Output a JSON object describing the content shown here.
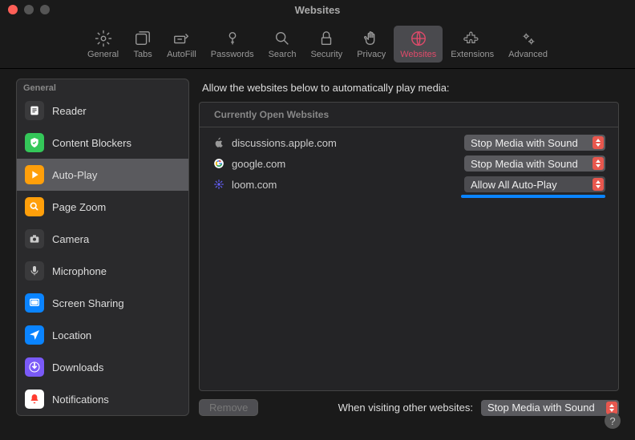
{
  "window_title": "Websites",
  "toolbar": [
    {
      "id": "general",
      "label": "General"
    },
    {
      "id": "tabs",
      "label": "Tabs"
    },
    {
      "id": "autofill",
      "label": "AutoFill"
    },
    {
      "id": "passwords",
      "label": "Passwords"
    },
    {
      "id": "search",
      "label": "Search"
    },
    {
      "id": "security",
      "label": "Security"
    },
    {
      "id": "privacy",
      "label": "Privacy"
    },
    {
      "id": "websites",
      "label": "Websites",
      "selected": true
    },
    {
      "id": "extensions",
      "label": "Extensions"
    },
    {
      "id": "advanced",
      "label": "Advanced"
    }
  ],
  "sidebar": {
    "header": "General",
    "items": [
      {
        "id": "reader",
        "label": "Reader"
      },
      {
        "id": "blockers",
        "label": "Content Blockers"
      },
      {
        "id": "autoplay",
        "label": "Auto-Play",
        "active": true
      },
      {
        "id": "zoom",
        "label": "Page Zoom"
      },
      {
        "id": "camera",
        "label": "Camera"
      },
      {
        "id": "mic",
        "label": "Microphone"
      },
      {
        "id": "share",
        "label": "Screen Sharing"
      },
      {
        "id": "location",
        "label": "Location"
      },
      {
        "id": "downloads",
        "label": "Downloads"
      },
      {
        "id": "notif",
        "label": "Notifications"
      }
    ]
  },
  "main": {
    "header": "Allow the websites below to automatically play media:",
    "list_title": "Currently Open Websites",
    "rows": [
      {
        "site": "discussions.apple.com",
        "value": "Stop Media with Sound",
        "icon": "apple"
      },
      {
        "site": "google.com",
        "value": "Stop Media with Sound",
        "icon": "google"
      },
      {
        "site": "loom.com",
        "value": "Allow All Auto-Play",
        "icon": "loom",
        "highlighted": true
      }
    ],
    "remove_label": "Remove",
    "footer_label": "When visiting other websites:",
    "footer_value": "Stop Media with Sound"
  }
}
